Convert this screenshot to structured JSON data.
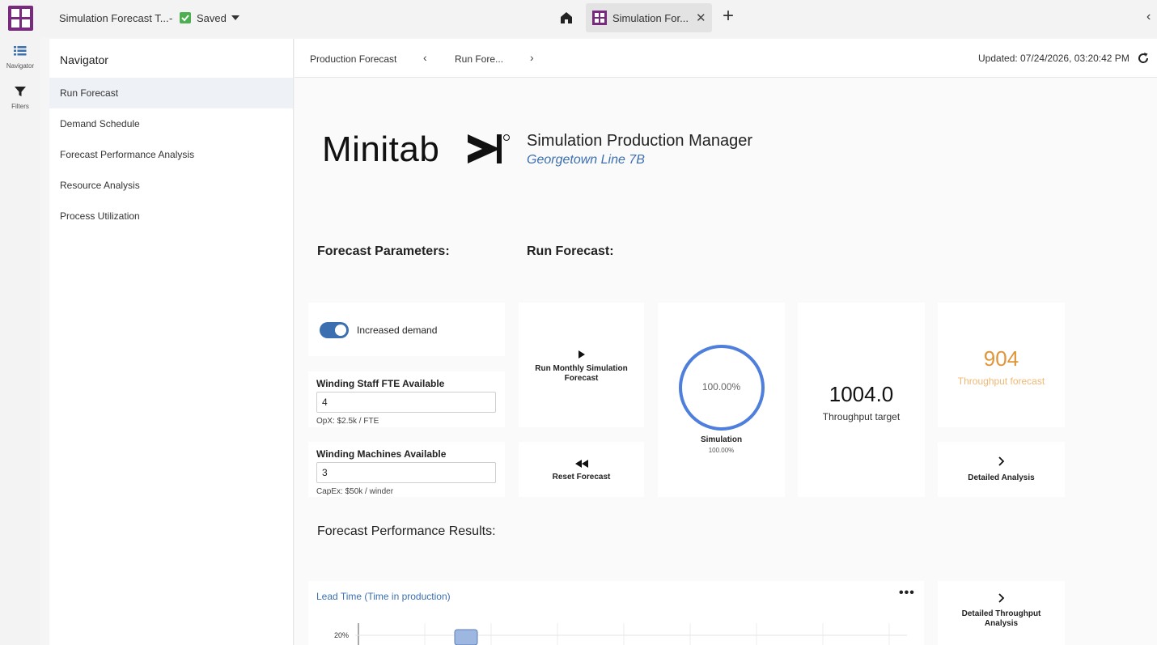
{
  "topbar": {
    "doc_title": "Simulation Forecast T...",
    "dash": "-",
    "saved_label": "Saved",
    "tab_label": "Simulation For...",
    "tab_close": "✕",
    "add_tab": "+",
    "collapse": "‹"
  },
  "rail": {
    "items": [
      {
        "label": "Navigator",
        "icon": "list-icon"
      },
      {
        "label": "Filters",
        "icon": "filter-icon"
      }
    ]
  },
  "navigator": {
    "title": "Navigator",
    "items": [
      {
        "label": "Run Forecast",
        "active": true
      },
      {
        "label": "Demand Schedule"
      },
      {
        "label": "Forecast Performance Analysis"
      },
      {
        "label": "Resource Analysis"
      },
      {
        "label": "Process Utilization"
      }
    ]
  },
  "breadcrumb": {
    "items": [
      "Production Forecast",
      "Run Fore..."
    ],
    "prev": "‹",
    "next": "›",
    "updated": "Updated: 07/24/2026, 03:20:42 PM"
  },
  "header": {
    "brand": "Minitab",
    "app_title": "Simulation Production Manager",
    "subtitle": "Georgetown Line 7B"
  },
  "sections": {
    "params": "Forecast Parameters:",
    "run": "Run Forecast:",
    "results": "Forecast Performance Results:"
  },
  "params": {
    "toggle_label": "Increased demand",
    "toggle_on": true,
    "staff_label": "Winding Staff FTE Available",
    "staff_value": "4",
    "staff_note": "OpX: $2.5k / FTE",
    "machines_label": "Winding Machines Available",
    "machines_value": "3",
    "machines_note": "CapEx: $50k / winder"
  },
  "run": {
    "run_label_1": "Run Monthly Simulation",
    "run_label_2": "Forecast",
    "reset_label": "Reset Forecast",
    "simulation_pct": "100.00%",
    "simulation_label": "Simulation",
    "simulation_sub": "100.00%",
    "simulation_progress": 1.0,
    "target_value": "1004.0",
    "target_label": "Throughput target",
    "forecast_value": "904",
    "forecast_label": "Throughput forecast",
    "detailed_label": "Detailed Analysis",
    "detailed_throughput_1": "Detailed Throughput",
    "detailed_throughput_2": "Analysis"
  },
  "results": {
    "chart_title": "Lead Time (Time in production)",
    "menu": "•••"
  },
  "colors": {
    "accent": "#3b6fb0",
    "brand_purple": "#7a2a7e",
    "forecast_orange": "#e0953a",
    "progress_ring": "#4f7fdc",
    "bar_fill": "#9db7e0"
  },
  "chart_data": {
    "type": "bar",
    "title": "Lead Time (Time in production)",
    "ytick_labels": [
      "20%"
    ],
    "ylim": [
      0,
      20
    ],
    "categories": [],
    "values": [
      20
    ],
    "grid": true
  }
}
